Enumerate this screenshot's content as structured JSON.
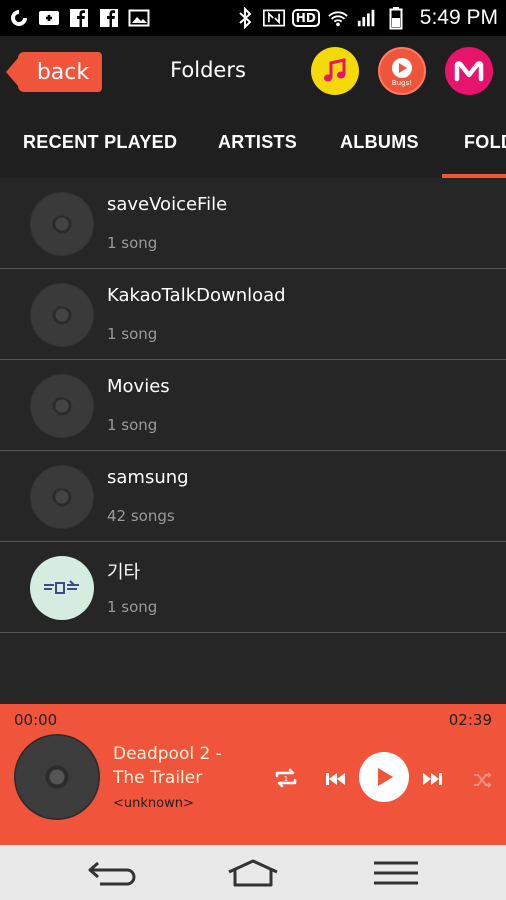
{
  "status_bar": {
    "time": "5:49 PM",
    "left_icons": [
      "app-icon",
      "video-icon",
      "facebook-icon",
      "facebook-icon",
      "gallery-icon"
    ],
    "right_icons": [
      "bluetooth-icon",
      "nfc-icon",
      "hd-icon",
      "wifi-icon",
      "signal-icon",
      "battery-icon"
    ],
    "hd_label": "HD"
  },
  "header": {
    "back_label": "back",
    "title": "Folders",
    "apps": [
      {
        "name": "music-app-icon",
        "color": "#f5d90a"
      },
      {
        "name": "bugs-app-icon",
        "color": "#f0553c",
        "label": "Bugs!"
      },
      {
        "name": "melon-app-icon",
        "color": "#e8136a"
      }
    ]
  },
  "tabs": [
    {
      "label": "RECENT PLAYED"
    },
    {
      "label": "ARTISTS"
    },
    {
      "label": "ALBUMS"
    },
    {
      "label": "FOLDERS",
      "active": true
    }
  ],
  "folders": [
    {
      "name": "saveVoiceFile",
      "count": "1 song"
    },
    {
      "name": "KakaoTalkDownload",
      "count": "1 song"
    },
    {
      "name": "Movies",
      "count": "1 song"
    },
    {
      "name": "samsung",
      "count": "42 songs"
    },
    {
      "name": "기타",
      "count": "1 song"
    }
  ],
  "player": {
    "elapsed": "00:00",
    "duration": "02:39",
    "title_line1": "Deadpool 2 -",
    "title_line2": "The Trailer",
    "artist": "<unknown>"
  },
  "colors": {
    "accent": "#f0553c",
    "list_bg": "#262626",
    "header_bg": "#1f1f1f"
  }
}
